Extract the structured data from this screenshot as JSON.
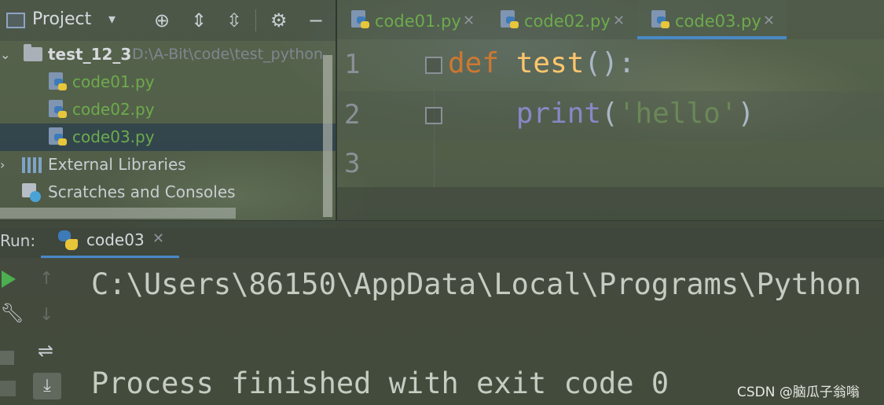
{
  "project_panel": {
    "title": "Project",
    "tree": [
      {
        "name": "test_12_3",
        "path": "D:\\A-Bit\\code\\test_python"
      },
      {
        "name": "code01.py"
      },
      {
        "name": "code02.py"
      },
      {
        "name": "code03.py"
      },
      {
        "name": "External Libraries"
      },
      {
        "name": "Scratches and Consoles"
      }
    ]
  },
  "editor": {
    "tabs": [
      {
        "label": "code01.py"
      },
      {
        "label": "code02.py"
      },
      {
        "label": "code03.py"
      }
    ],
    "line_numbers": [
      "1",
      "2",
      "3"
    ],
    "code": {
      "line1": {
        "keyword": "def",
        "function": "test",
        "rest": "():"
      },
      "line2": {
        "builtin": "print",
        "open": "(",
        "string": "'hello'",
        "close": ")"
      }
    }
  },
  "run_panel": {
    "label": "Run:",
    "tab_label": "code03",
    "output": [
      "C:\\Users\\86150\\AppData\\Local\\Programs\\Python",
      "Process finished with exit code 0"
    ]
  },
  "watermark": "CSDN @脑瓜子翁嗡"
}
